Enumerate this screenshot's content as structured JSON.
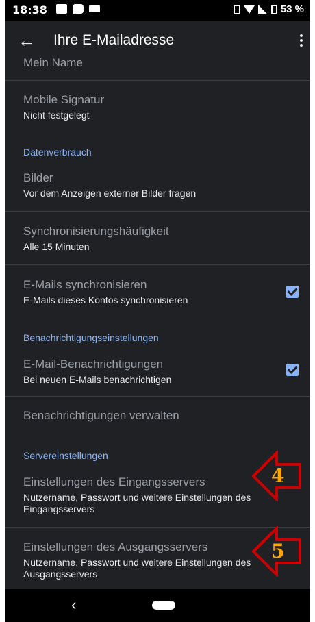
{
  "status_bar": {
    "time": "18:38",
    "battery": "53 %"
  },
  "app_bar": {
    "title": "Ihre E-Mailadresse"
  },
  "items": {
    "mein_name": {
      "title": "Mein Name"
    },
    "mobile_signatur": {
      "title": "Mobile Signatur",
      "subtitle": "Nicht festgelegt"
    },
    "bilder": {
      "title": "Bilder",
      "subtitle": "Vor dem Anzeigen externer Bilder fragen"
    },
    "sync_freq": {
      "title": "Synchronisierungshäufigkeit",
      "subtitle": "Alle 15 Minuten"
    },
    "emails_sync": {
      "title": "E-Mails synchronisieren",
      "subtitle": "E-Mails dieses Kontos synchronisieren",
      "checked": true
    },
    "email_notif": {
      "title": "E-Mail-Benachrichtigungen",
      "subtitle": "Bei neuen E-Mails benachrichtigen",
      "checked": true
    },
    "notif_manage": {
      "title": "Benachrichtigungen verwalten"
    },
    "incoming_server": {
      "title": "Einstellungen des Eingangsservers",
      "subtitle": "Nutzername, Passwort und weitere Einstellungen des Eingangsservers"
    },
    "outgoing_server": {
      "title": "Einstellungen des Ausgangsservers",
      "subtitle": "Nutzername, Passwort und weitere Einstellungen des Ausgangsservers"
    }
  },
  "sections": {
    "data": "Datenverbrauch",
    "notifications": "Benachrichtigungseinstellungen",
    "server": "Servereinstellungen"
  },
  "annotations": {
    "arrow_4": "4",
    "arrow_5": "5"
  },
  "colors": {
    "background": "#202124",
    "accent": "#8ab4f8",
    "arrow_red": "#cc0000",
    "number_orange": "#ffa500"
  }
}
